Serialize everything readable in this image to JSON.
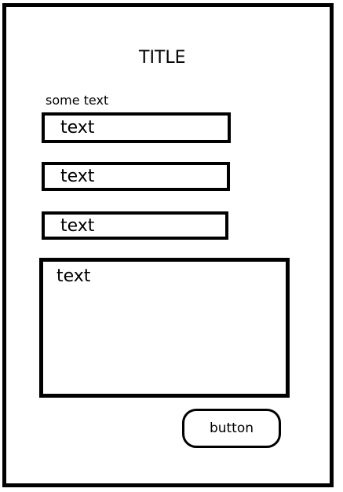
{
  "form": {
    "title": "TITLE",
    "label": "some text",
    "fields": [
      {
        "placeholder": "text"
      },
      {
        "placeholder": "text"
      },
      {
        "placeholder": "text"
      }
    ],
    "textarea": {
      "placeholder": "text"
    },
    "button_label": "button"
  },
  "colors": {
    "border": "#000000",
    "background": "#ffffff"
  }
}
